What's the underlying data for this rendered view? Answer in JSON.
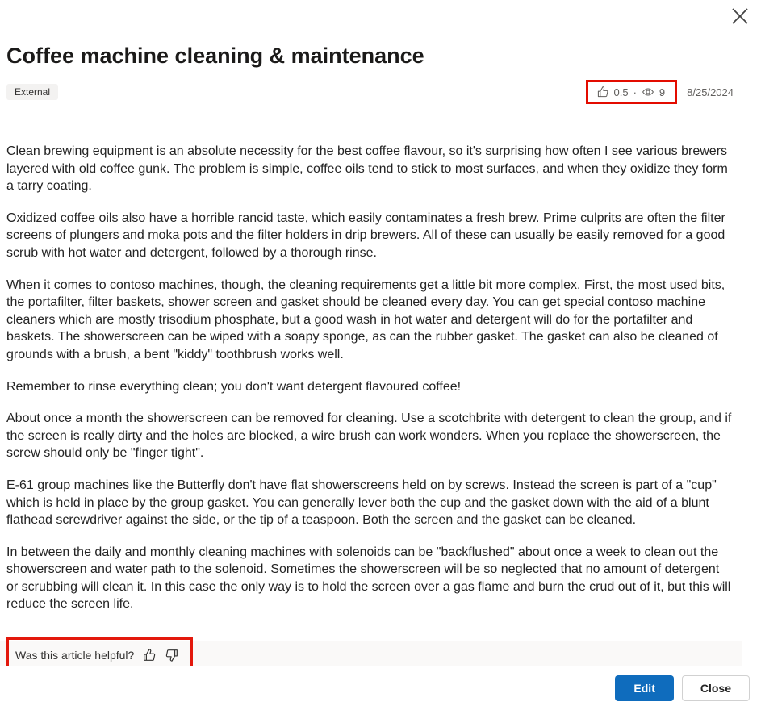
{
  "header": {
    "title": "Coffee machine cleaning & maintenance",
    "tag": "External",
    "likes": "0.5",
    "views": "9",
    "date": "8/25/2024"
  },
  "paragraphs": [
    "Clean brewing equipment is an absolute necessity for the best coffee flavour, so it's surprising how often I see various brewers layered with old coffee gunk. The problem is simple, coffee oils tend to stick to most surfaces, and when they oxidize they form a tarry coating.",
    "Oxidized coffee oils also have a horrible rancid taste, which easily contaminates a fresh brew. Prime culprits are often the filter screens of plungers and moka pots and the filter holders in drip brewers. All of these can usually be easily removed for a good scrub with hot water and detergent, followed by a thorough rinse.",
    "When it comes to contoso machines, though, the cleaning requirements get a little bit more complex. First, the most used bits, the portafilter, filter baskets, shower screen and gasket should be cleaned every day. You can get special contoso machine cleaners which are mostly trisodium phosphate, but a good wash in hot water and detergent will do for the portafilter and baskets. The showerscreen can be wiped with a soapy sponge, as can the rubber gasket. The gasket can also be cleaned of grounds with a brush, a bent \"kiddy\" toothbrush works well.",
    "Remember to rinse everything clean; you don't want detergent flavoured coffee!",
    "About once a month the showerscreen can be removed for cleaning. Use a scotchbrite with detergent to clean the group, and if the screen is really dirty and the holes are blocked, a wire brush can work wonders. When you replace the showerscreen, the screw should only be \"finger tight\".",
    "E-61 group machines like the Butterfly don't have flat showerscreens held on by screws. Instead the screen is part of a \"cup\" which is held in place by the group gasket. You can generally lever both the cup and the gasket down with the aid of a blunt flathead screwdriver against the side, or the tip of a teaspoon. Both the screen and the gasket can be cleaned.",
    "In between the daily and monthly cleaning machines with solenoids can be \"backflushed\" about once a week to clean out the showerscreen and water path to the solenoid. Sometimes the showerscreen will be so neglected that no amount of detergent or scrubbing will clean it. In this case the only way is to hold the screen over a gas flame and burn the crud out of it, but this will reduce the screen life."
  ],
  "feedback": {
    "prompt": "Was this article helpful?"
  },
  "footer": {
    "edit_label": "Edit",
    "close_label": "Close"
  }
}
